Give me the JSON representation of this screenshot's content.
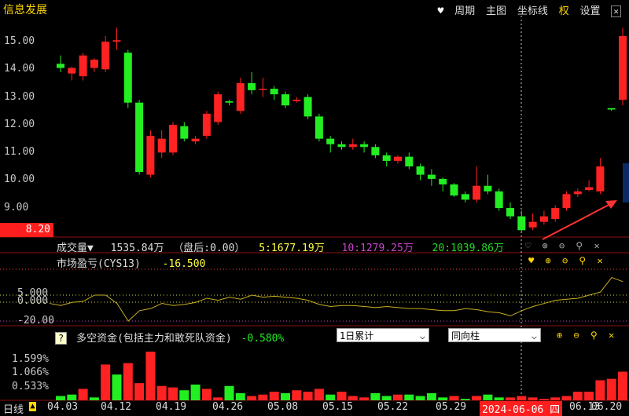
{
  "stock_name": "信息发展",
  "menu": {
    "period": "周期",
    "main_chart": "主图",
    "coord_line": "坐标线",
    "rights": "权",
    "settings": "设置"
  },
  "price_axis": [
    "15.00",
    "14.00",
    "13.00",
    "12.00",
    "11.00",
    "10.00",
    "9.00"
  ],
  "price_low_label": "8.20",
  "volume_panel": {
    "title": "成交量▼",
    "value": "1535.84万",
    "after_hours": "（盘后:",
    "after_hours_value": "0.00",
    "after_close": "）",
    "ma5": "5:1677.19万",
    "ma10": "10:1279.25万",
    "ma20": "20:1039.86万"
  },
  "cys_panel": {
    "title": "市场盈亏(CYS13)",
    "value": "-16.500",
    "axis": [
      "5.000",
      "0.000",
      "-20.00"
    ]
  },
  "fund_panel": {
    "help": "?",
    "title": "多空资金(包括主力和敢死队资金)",
    "value": "-0.580%",
    "select1": "1日累计",
    "select2": "同向柱",
    "axis": [
      "1.599%",
      "1.066%",
      "0.533%"
    ]
  },
  "bottom_bar": {
    "period_label": "日线",
    "dates": [
      "04.03",
      "04.12",
      "04.19",
      "04.26",
      "05.08",
      "05.15",
      "05.22",
      "05.29",
      "06.13",
      "06.20"
    ],
    "cursor_date": "2024-06-06 四"
  },
  "colors": {
    "up": "#ff2222",
    "down": "#22ee22",
    "ma5": "#ffff44",
    "ma10": "#cc44cc",
    "ma20": "#22dd22",
    "cys": "#c8b020",
    "accent": "#ff1e1e"
  },
  "chart_data": {
    "type": "candlestick",
    "ylim": [
      8.2,
      15.5
    ],
    "candles": [
      {
        "o": 14.2,
        "c": 14.05,
        "h": 14.5,
        "l": 13.9
      },
      {
        "o": 13.85,
        "c": 14.05,
        "h": 14.1,
        "l": 13.6
      },
      {
        "o": 13.75,
        "c": 14.5,
        "h": 14.6,
        "l": 13.6
      },
      {
        "o": 14.05,
        "c": 14.35,
        "h": 14.4,
        "l": 13.9
      },
      {
        "o": 14.0,
        "c": 15.0,
        "h": 15.2,
        "l": 13.9
      },
      {
        "o": 15.0,
        "c": 15.05,
        "h": 15.5,
        "l": 14.7
      },
      {
        "o": 14.6,
        "c": 12.8,
        "h": 14.7,
        "l": 12.6
      },
      {
        "o": 12.8,
        "c": 10.3,
        "h": 12.9,
        "l": 10.2
      },
      {
        "o": 10.2,
        "c": 11.6,
        "h": 11.8,
        "l": 10.1
      },
      {
        "o": 11.0,
        "c": 11.5,
        "h": 11.8,
        "l": 10.8
      },
      {
        "o": 11.0,
        "c": 12.0,
        "h": 12.1,
        "l": 10.9
      },
      {
        "o": 11.95,
        "c": 11.5,
        "h": 12.1,
        "l": 11.4
      },
      {
        "o": 11.4,
        "c": 11.5,
        "h": 11.6,
        "l": 11.3
      },
      {
        "o": 11.6,
        "c": 12.4,
        "h": 12.5,
        "l": 11.5
      },
      {
        "o": 12.1,
        "c": 13.1,
        "h": 13.2,
        "l": 12.0
      },
      {
        "o": 12.85,
        "c": 12.8,
        "h": 12.9,
        "l": 12.7
      },
      {
        "o": 12.5,
        "c": 13.5,
        "h": 13.7,
        "l": 12.4
      },
      {
        "o": 13.5,
        "c": 13.25,
        "h": 13.9,
        "l": 13.1
      },
      {
        "o": 13.3,
        "c": 13.3,
        "h": 13.7,
        "l": 13.0
      },
      {
        "o": 13.3,
        "c": 13.1,
        "h": 13.4,
        "l": 12.9
      },
      {
        "o": 13.1,
        "c": 12.7,
        "h": 13.2,
        "l": 12.6
      },
      {
        "o": 12.85,
        "c": 12.9,
        "h": 13.0,
        "l": 12.8
      },
      {
        "o": 13.0,
        "c": 12.3,
        "h": 13.1,
        "l": 12.2
      },
      {
        "o": 12.3,
        "c": 11.5,
        "h": 12.4,
        "l": 11.4
      },
      {
        "o": 11.5,
        "c": 11.3,
        "h": 11.6,
        "l": 11.0
      },
      {
        "o": 11.3,
        "c": 11.2,
        "h": 11.4,
        "l": 11.1
      },
      {
        "o": 11.2,
        "c": 11.3,
        "h": 11.5,
        "l": 11.1
      },
      {
        "o": 11.3,
        "c": 11.2,
        "h": 11.4,
        "l": 11.0
      },
      {
        "o": 11.2,
        "c": 10.9,
        "h": 11.3,
        "l": 10.8
      },
      {
        "o": 10.9,
        "c": 10.7,
        "h": 11.0,
        "l": 10.5
      },
      {
        "o": 10.7,
        "c": 10.85,
        "h": 10.9,
        "l": 10.6
      },
      {
        "o": 10.85,
        "c": 10.5,
        "h": 11.0,
        "l": 10.4
      },
      {
        "o": 10.5,
        "c": 10.2,
        "h": 10.6,
        "l": 10.0
      },
      {
        "o": 10.2,
        "c": 10.05,
        "h": 10.4,
        "l": 9.8
      },
      {
        "o": 10.05,
        "c": 9.85,
        "h": 10.1,
        "l": 9.6
      },
      {
        "o": 9.85,
        "c": 9.45,
        "h": 9.9,
        "l": 9.4
      },
      {
        "o": 9.5,
        "c": 9.3,
        "h": 9.6,
        "l": 9.2
      },
      {
        "o": 9.3,
        "c": 9.8,
        "h": 10.5,
        "l": 9.2
      },
      {
        "o": 9.8,
        "c": 9.6,
        "h": 10.2,
        "l": 9.5
      },
      {
        "o": 9.6,
        "c": 9.0,
        "h": 9.7,
        "l": 8.9
      },
      {
        "o": 9.0,
        "c": 8.7,
        "h": 9.2,
        "l": 8.6
      },
      {
        "o": 8.7,
        "c": 8.2,
        "h": 8.9,
        "l": 8.1
      },
      {
        "o": 8.3,
        "c": 8.5,
        "h": 8.8,
        "l": 8.2
      },
      {
        "o": 8.5,
        "c": 8.7,
        "h": 8.9,
        "l": 8.4
      },
      {
        "o": 8.6,
        "c": 9.0,
        "h": 9.1,
        "l": 8.5
      },
      {
        "o": 9.0,
        "c": 9.5,
        "h": 9.6,
        "l": 8.9
      },
      {
        "o": 9.5,
        "c": 9.6,
        "h": 9.7,
        "l": 9.4
      },
      {
        "o": 9.65,
        "c": 9.75,
        "h": 10.0,
        "l": 9.6
      },
      {
        "o": 9.6,
        "c": 10.5,
        "h": 10.8,
        "l": 9.5
      },
      {
        "o": 12.6,
        "c": 12.55,
        "h": 12.6,
        "l": 12.5
      },
      {
        "o": 12.9,
        "c": 15.2,
        "h": 15.5,
        "l": 12.7
      }
    ],
    "volume_colors": [
      "g",
      "g",
      "r",
      "g",
      "r",
      "g",
      "r",
      "r",
      "r",
      "r",
      "r",
      "g",
      "g",
      "r",
      "r",
      "g",
      "g",
      "r",
      "r",
      "r",
      "g",
      "r",
      "r",
      "r",
      "g",
      "r",
      "r",
      "r",
      "g",
      "g",
      "r",
      "g",
      "g",
      "g",
      "g",
      "r",
      "g",
      "r",
      "g",
      "g",
      "r",
      "r",
      "r",
      "r",
      "r",
      "r",
      "r",
      "r",
      "r",
      "r",
      "r"
    ],
    "volume_values": [
      0.15,
      0.2,
      0.4,
      0.1,
      1.25,
      0.9,
      1.3,
      0.6,
      1.7,
      0.5,
      0.45,
      0.35,
      0.55,
      0.4,
      0.1,
      0.5,
      0.25,
      0.15,
      0.2,
      0.3,
      0.25,
      0.35,
      0.3,
      0.4,
      0.2,
      0.3,
      0.15,
      0.1,
      0.25,
      0.15,
      0.2,
      0.2,
      0.15,
      0.25,
      0.1,
      0.15,
      0.05,
      0.15,
      0.2,
      0.1,
      0.1,
      0.15,
      0.1,
      0.05,
      0.1,
      0.15,
      0.3,
      0.3,
      0.7,
      0.75,
      1.0
    ],
    "cys_values": [
      -3,
      -5,
      -2,
      -1,
      5,
      5,
      -3,
      -20,
      -10,
      -8,
      -3,
      -5,
      -4,
      -2,
      2,
      0,
      3,
      1,
      5,
      3,
      4,
      3,
      2,
      0,
      -4,
      -6,
      -5,
      -5,
      -6,
      -7,
      -6,
      -7,
      -8,
      -8,
      -9,
      -10,
      -10,
      -8,
      -9,
      -11,
      -12,
      -15,
      -10,
      -6,
      -3,
      0,
      1,
      2,
      5,
      8,
      22,
      18
    ]
  }
}
